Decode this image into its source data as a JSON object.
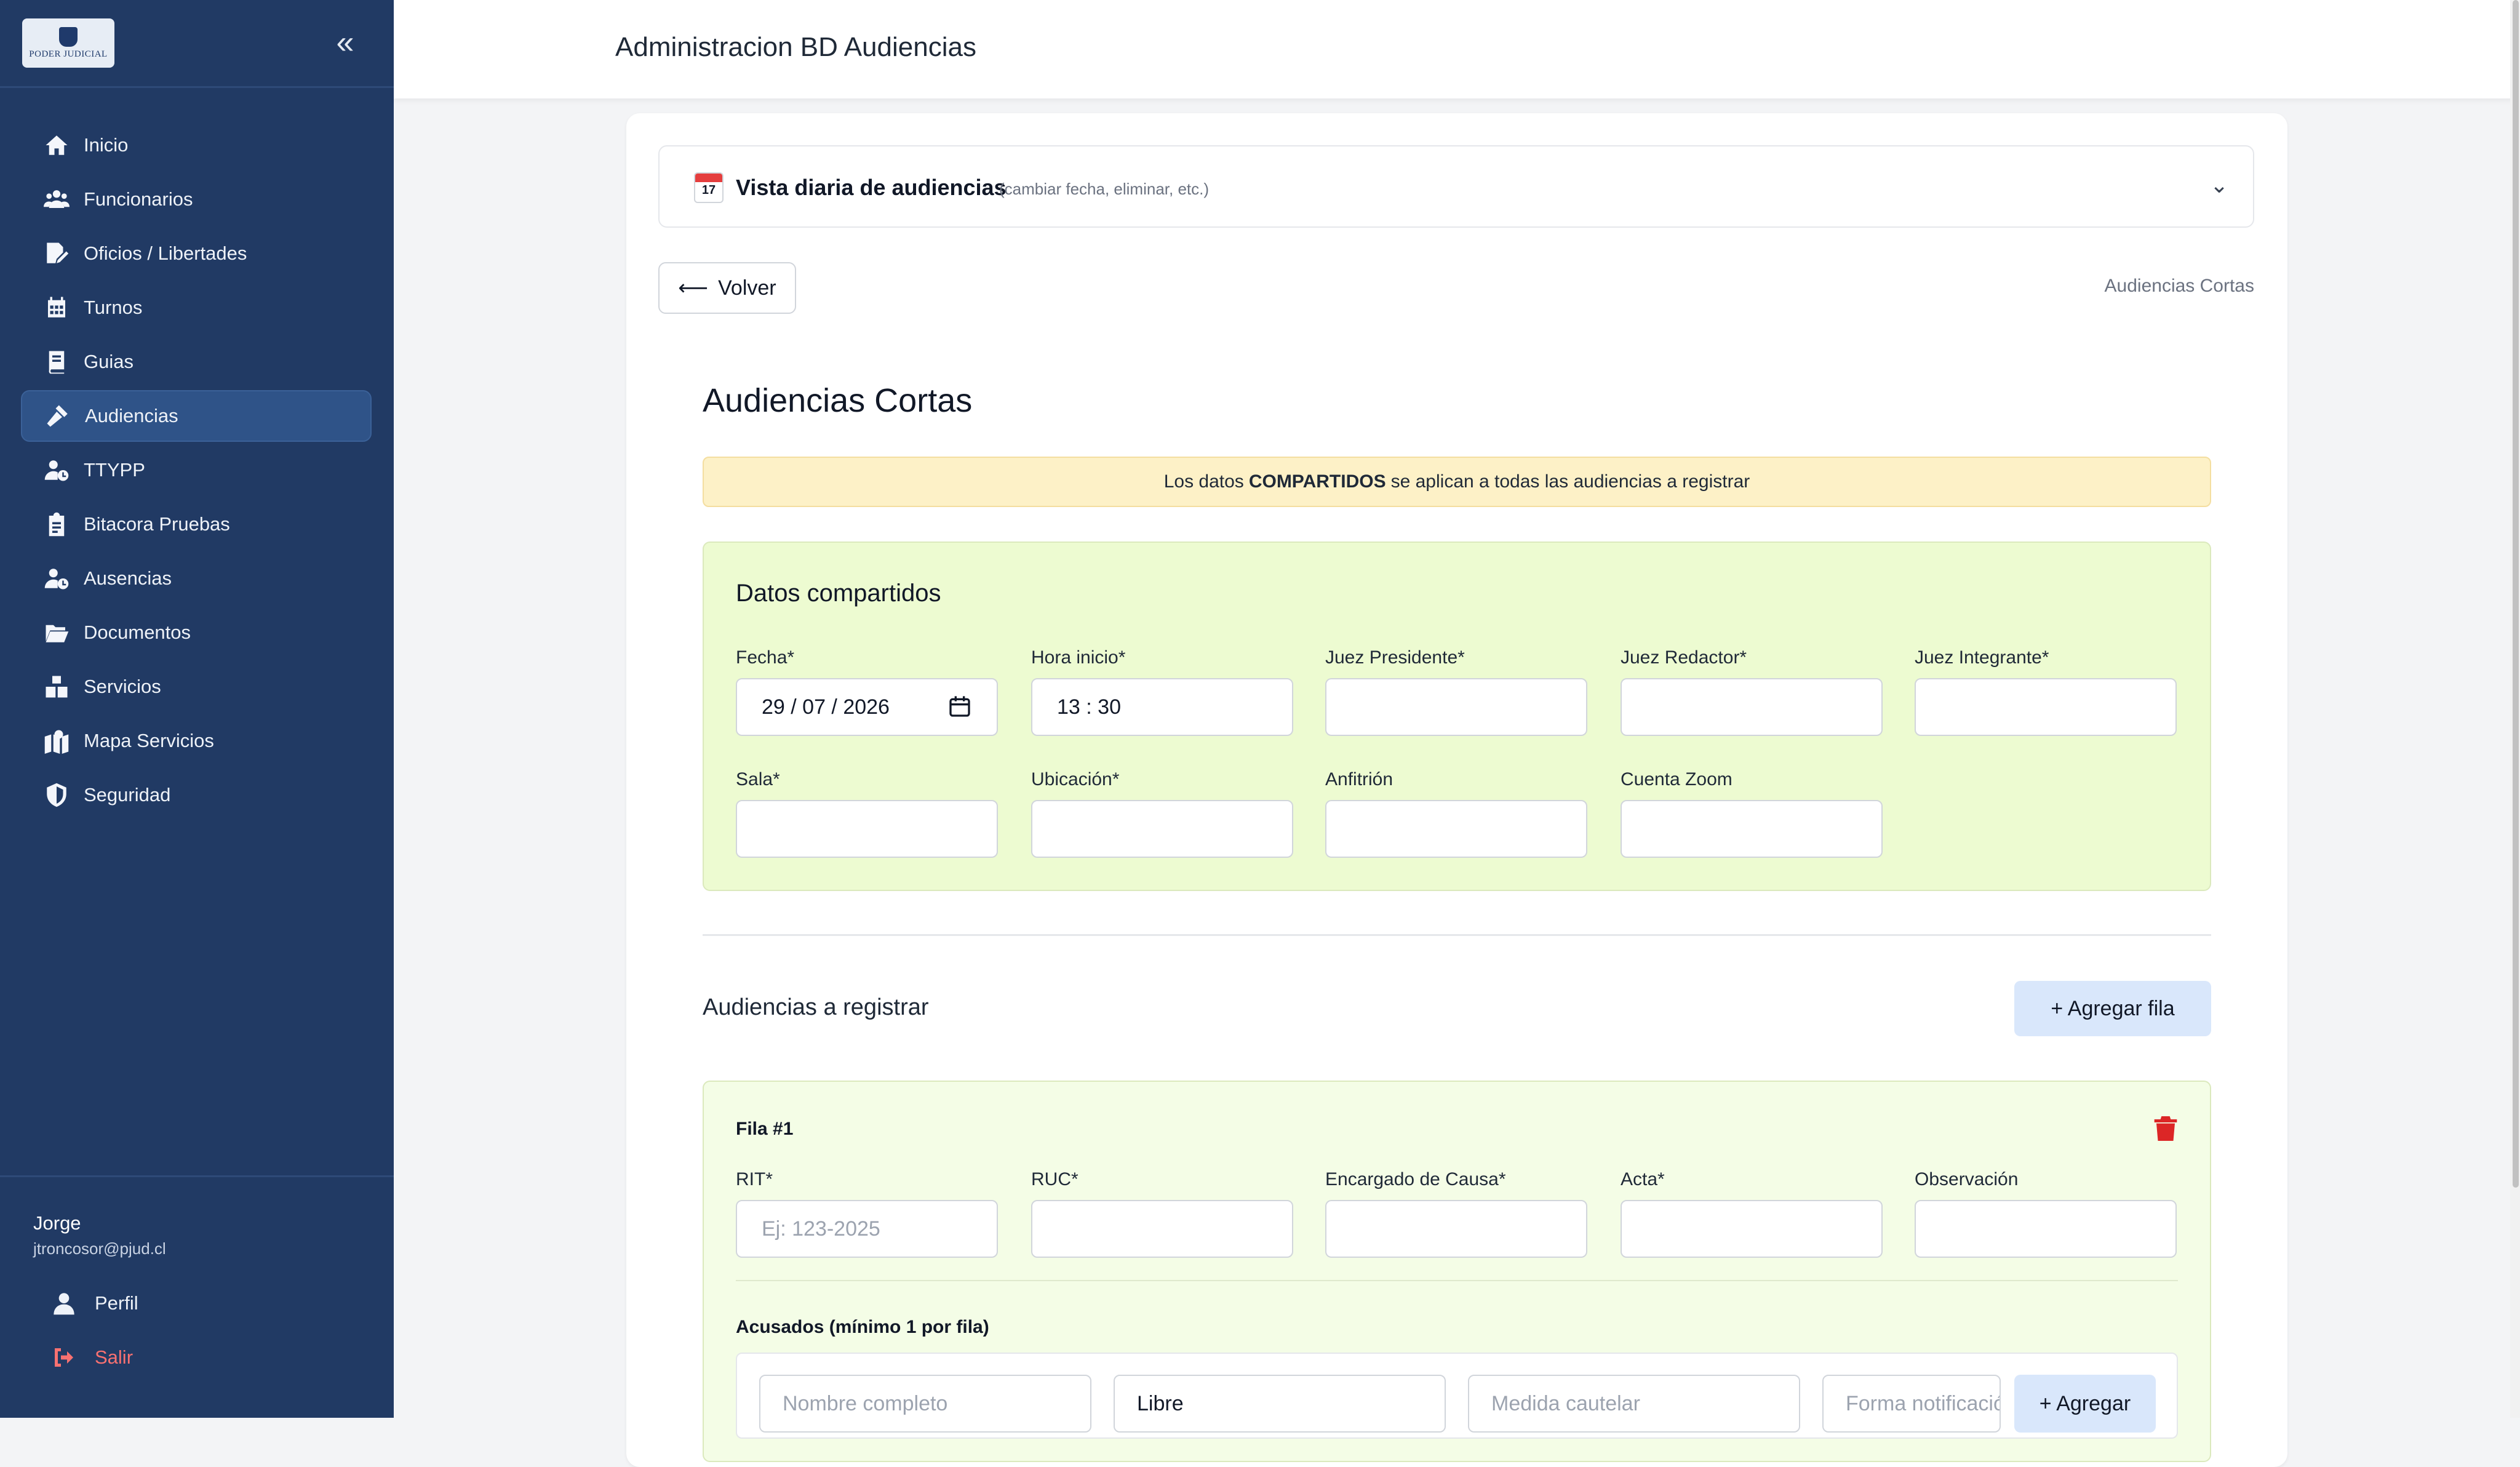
{
  "app": {
    "logo_text": "PODER JUDICIAL",
    "collapse_icon": "double-chevron-left-icon"
  },
  "sidebar": {
    "items": [
      {
        "label": "Inicio",
        "icon": "home-icon"
      },
      {
        "label": "Funcionarios",
        "icon": "users-icon"
      },
      {
        "label": "Oficios / Libertades",
        "icon": "document-edit-icon"
      },
      {
        "label": "Turnos",
        "icon": "calendar-icon"
      },
      {
        "label": "Guias",
        "icon": "book-icon"
      },
      {
        "label": "Audiencias",
        "icon": "gavel-icon",
        "active": true
      },
      {
        "label": "TTYPP",
        "icon": "user-clock-icon"
      },
      {
        "label": "Bitacora Pruebas",
        "icon": "clipboard-icon"
      },
      {
        "label": "Ausencias",
        "icon": "user-clock-icon"
      },
      {
        "label": "Documentos",
        "icon": "folder-open-icon"
      },
      {
        "label": "Servicios",
        "icon": "cubes-icon"
      },
      {
        "label": "Mapa Servicios",
        "icon": "map-pin-icon"
      },
      {
        "label": "Seguridad",
        "icon": "shield-icon"
      }
    ],
    "user": {
      "name": "Jorge",
      "email": "jtroncosor@pjud.cl"
    },
    "footer": {
      "profile_label": "Perfil",
      "logout_label": "Salir"
    },
    "colors": {
      "background": "#213a64",
      "active": "#2f5388",
      "logout": "#f87171"
    }
  },
  "header": {
    "title": "Administracion BD Audiencias"
  },
  "accordion": {
    "title": "Vista diaria de audiencias",
    "hint": "(cambiar fecha, eliminar, etc.)",
    "calendar_day": "17",
    "icon": "calendar-icon",
    "chevron_icon": "chevron-down-icon"
  },
  "nav": {
    "back_label": "Volver",
    "breadcrumb": "Audiencias Cortas"
  },
  "main": {
    "section_title": "Audiencias Cortas",
    "notice": {
      "prefix": "Los datos",
      "emphasis": "COMPARTIDOS",
      "suffix": "se aplican a todas las audiencias a registrar"
    },
    "shared": {
      "title": "Datos compartidos",
      "fields": {
        "fecha": {
          "label": "Fecha*",
          "value": "29 / 07 / 2026"
        },
        "hora": {
          "label": "Hora inicio*",
          "value": "13 : 30"
        },
        "juez_presidente": {
          "label": "Juez Presidente*",
          "value": ""
        },
        "juez_redactor": {
          "label": "Juez Redactor*",
          "value": ""
        },
        "juez_integrante": {
          "label": "Juez Integrante*",
          "value": ""
        },
        "sala": {
          "label": "Sala*",
          "value": ""
        },
        "ubicacion": {
          "label": "Ubicación*",
          "value": ""
        },
        "anfitrion": {
          "label": "Anfitrión",
          "value": ""
        },
        "cuenta_zoom": {
          "label": "Cuenta Zoom",
          "value": ""
        }
      }
    },
    "rows_section": {
      "title": "Audiencias a registrar",
      "add_label": "+ Agregar fila"
    },
    "row": {
      "title": "Fila #1",
      "fields": {
        "rit": {
          "label": "RIT*",
          "placeholder": "Ej: 123-2025"
        },
        "ruc": {
          "label": "RUC*",
          "value": ""
        },
        "encargado": {
          "label": "Encargado de Causa*",
          "value": ""
        },
        "acta": {
          "label": "Acta*",
          "value": ""
        },
        "observacion": {
          "label": "Observación",
          "value": ""
        }
      },
      "accused": {
        "title": "Acusados (mínimo 1 por fila)",
        "name_placeholder": "Nombre completo",
        "status_value": "Libre",
        "measure_placeholder": "Medida cautelar",
        "notify_placeholder": "Forma notificación",
        "add_label": "+ Agregar"
      },
      "delete_icon": "trash-icon"
    }
  }
}
